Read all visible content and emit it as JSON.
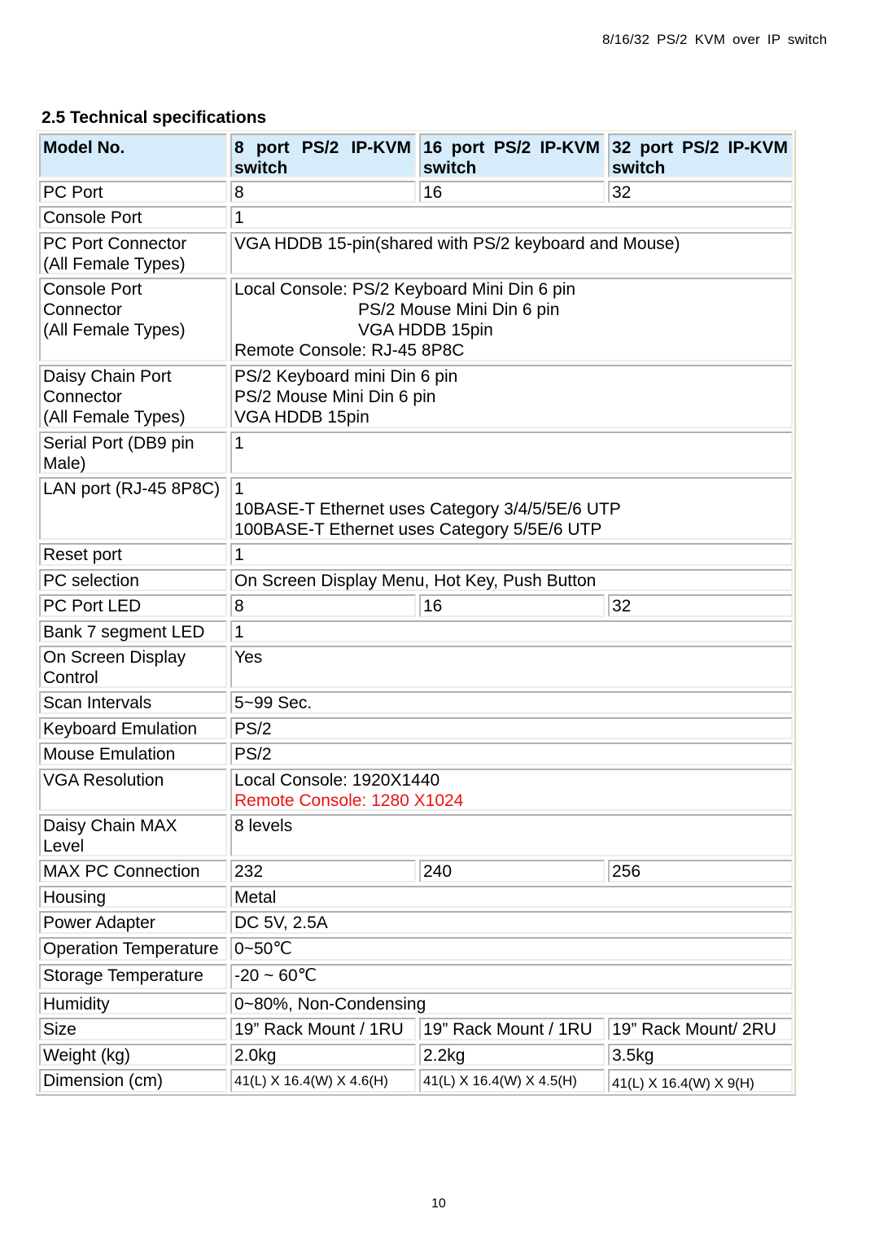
{
  "page": {
    "running_header": "8/16/32 PS/2 KVM over IP switch",
    "section_title": "2.5 Technical specifications",
    "page_number": "10"
  },
  "colors": {
    "header_bg": "#d6ecfb",
    "highlight_text": "#ee1111"
  },
  "table": {
    "header": {
      "label": "Model No.",
      "models": [
        [
          "8",
          "port",
          "PS/2",
          "IP-KVM",
          "switch"
        ],
        [
          "16",
          "port",
          "PS/2",
          "IP-KVM",
          "switch"
        ],
        [
          "32",
          "port",
          "PS/2",
          "IP-KVM",
          "switch"
        ]
      ]
    },
    "rows": [
      {
        "label": [
          "PC Port"
        ],
        "values": [
          "8",
          "16",
          "32"
        ]
      },
      {
        "label": [
          "Console Port"
        ],
        "value": [
          "1"
        ]
      },
      {
        "label": [
          "PC Port Connector",
          "(All Female Types)"
        ],
        "value": [
          "VGA HDDB 15-pin(shared with PS/2 keyboard and Mouse)"
        ]
      },
      {
        "label": [
          "Console Port",
          "Connector",
          "(All Female Types)"
        ],
        "value": [
          "Local Console: PS/2 Keyboard Mini Din 6 pin",
          "PS/2 Mouse Mini Din 6 pin",
          "VGA HDDB 15pin",
          "Remote Console: RJ-45 8P8C"
        ]
      },
      {
        "label": [
          "Daisy Chain Port",
          "Connector",
          "(All Female Types)"
        ],
        "value": [
          "PS/2 Keyboard mini Din 6 pin",
          "PS/2 Mouse Mini Din 6 pin",
          "VGA HDDB 15pin"
        ]
      },
      {
        "label": [
          "Serial Port (DB9 pin",
          "Male)"
        ],
        "value": [
          "1"
        ]
      },
      {
        "label": [
          "LAN port (RJ-45 8P8C)"
        ],
        "value": [
          "1",
          "10BASE-T Ethernet uses Category 3/4/5/5E/6 UTP",
          "100BASE-T Ethernet uses Category 5/5E/6 UTP"
        ]
      },
      {
        "label": [
          "Reset port"
        ],
        "value": [
          "1"
        ]
      },
      {
        "label": [
          "PC selection"
        ],
        "value": [
          "On Screen Display Menu, Hot Key, Push Button"
        ]
      },
      {
        "label": [
          "PC Port LED"
        ],
        "values": [
          "8",
          "16",
          "32"
        ]
      },
      {
        "label": [
          "Bank 7 segment LED"
        ],
        "value": [
          "1"
        ]
      },
      {
        "label": [
          "On Screen Display",
          "Control"
        ],
        "value": [
          "Yes"
        ]
      },
      {
        "label": [
          "Scan Intervals"
        ],
        "value": [
          "5~99 Sec."
        ]
      },
      {
        "label": [
          "Keyboard Emulation"
        ],
        "value": [
          "PS/2"
        ]
      },
      {
        "label": [
          "Mouse Emulation"
        ],
        "value": [
          "PS/2"
        ]
      },
      {
        "label": [
          "VGA Resolution"
        ],
        "value": [
          "Local Console: 1920X1440",
          "Remote Console: 1280 X1024"
        ]
      },
      {
        "label": [
          "Daisy Chain MAX",
          "Level"
        ],
        "value": [
          "8 levels"
        ]
      },
      {
        "label": [
          "MAX PC Connection"
        ],
        "values": [
          "232",
          "240",
          "256"
        ]
      },
      {
        "label": [
          "Housing"
        ],
        "value": [
          "Metal"
        ]
      },
      {
        "label": [
          "Power Adapter"
        ],
        "value": [
          "DC 5V, 2.5A"
        ]
      },
      {
        "label": [
          "Operation Temperature"
        ],
        "value": [
          "0~50℃"
        ]
      },
      {
        "label": [
          "Storage Temperature"
        ],
        "value": [
          "-20 ~ 60℃"
        ]
      },
      {
        "label": [
          "Humidity"
        ],
        "value": [
          "0~80%, Non-Condensing"
        ]
      },
      {
        "label": [
          "Size"
        ],
        "values": [
          "19” Rack Mount / 1RU",
          "19” Rack Mount / 1RU",
          "19” Rack Mount/ 2RU"
        ]
      },
      {
        "label": [
          "Weight (kg)"
        ],
        "values": [
          "2.0kg",
          "2.2kg",
          "3.5kg"
        ]
      },
      {
        "label": [
          "Dimension (cm)"
        ],
        "values": [
          "41(L) X 16.4(W) X 4.6(H)",
          "41(L) X 16.4(W) X 4.5(H)",
          "41(L) X 16.4(W) X 9(H)"
        ]
      }
    ]
  }
}
